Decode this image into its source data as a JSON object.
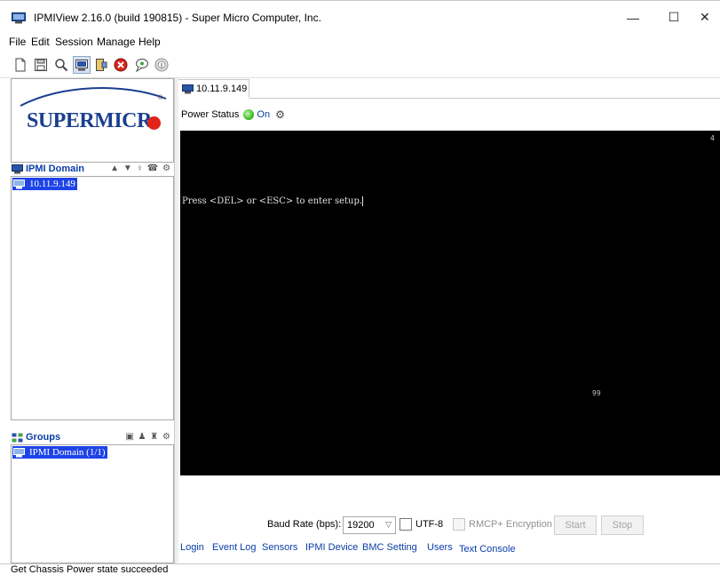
{
  "window": {
    "title": "IPMIView 2.16.0 (build 190815) - Super Micro Computer, Inc.",
    "minimize_glyph": "—",
    "maximize_glyph": "☐",
    "close_glyph": "✕"
  },
  "menu": {
    "items": [
      "File",
      "Edit",
      "Session",
      "Manage",
      "Help"
    ]
  },
  "toolbar": {
    "buttons": [
      "new-icon",
      "save-icon",
      "search-icon",
      "monitor-icon",
      "logout-icon",
      "stop-icon",
      "chat-icon",
      "info-icon"
    ]
  },
  "logo": {
    "text": "SUPERMICR",
    "registered": "®",
    "brand_blue": "#1b3f8f",
    "brand_red": "#e2231a"
  },
  "ipmi_domain": {
    "header": "IPMI Domain",
    "tools": "▲ ▼ ♀ ☎ ⚙",
    "items": [
      {
        "label": "10.11.9.149",
        "selected": true
      }
    ]
  },
  "groups": {
    "header": "Groups",
    "tools": "▣ ♟ ♜ ⚙",
    "items": [
      {
        "label": "IPMI Domain (1/1)",
        "selected": true
      }
    ]
  },
  "session_tab": {
    "label": "10.11.9.149"
  },
  "power": {
    "label": "Power Status",
    "state": "On",
    "refresh_glyph": "⚙"
  },
  "console": {
    "corner_marker": "4",
    "line": "Press <DEL> or <ESC> to enter setup.",
    "post_code": "99"
  },
  "controls": {
    "baud_label": "Baud Rate (bps):",
    "baud_value": "19200",
    "utf8_label": "UTF-8",
    "rmcp_label": "RMCP+ Encryption",
    "start_label": "Start",
    "stop_label": "Stop"
  },
  "bottom_tabs": {
    "items": [
      "Login",
      "Event Log",
      "Sensors",
      "IPMI Device",
      "BMC Setting",
      "Users",
      "Text Console"
    ],
    "active": "Text Console"
  },
  "status": {
    "text": "Get Chassis Power state succeeded"
  }
}
